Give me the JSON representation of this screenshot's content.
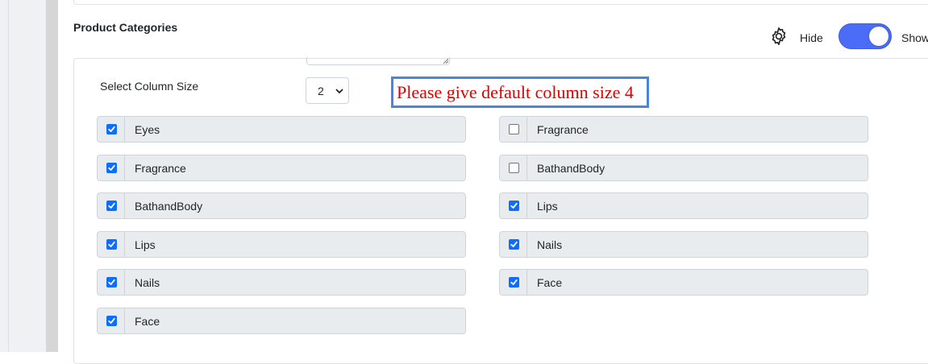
{
  "section": {
    "title": "Product Categories",
    "hide_label": "Hide",
    "show_label": "Show",
    "toggle_state": "show"
  },
  "column_size": {
    "label": "Select Column Size",
    "selected": "2"
  },
  "annotation": {
    "text": "Please give default column size 4"
  },
  "categories_left": [
    {
      "label": "Eyes",
      "checked": true
    },
    {
      "label": "Fragrance",
      "checked": true
    },
    {
      "label": "BathandBody",
      "checked": true
    },
    {
      "label": "Lips",
      "checked": true
    },
    {
      "label": "Nails",
      "checked": true
    },
    {
      "label": "Face",
      "checked": true
    }
  ],
  "categories_right": [
    {
      "label": "Fragrance",
      "checked": false
    },
    {
      "label": "BathandBody",
      "checked": false
    },
    {
      "label": "Lips",
      "checked": true
    },
    {
      "label": "Nails",
      "checked": true
    },
    {
      "label": "Face",
      "checked": true
    }
  ],
  "colors": {
    "toggle_on": "#4a6cf7",
    "checkbox_checked": "#0d6efd",
    "annotation_border": "#4a86d8",
    "annotation_text": "#e00000"
  }
}
